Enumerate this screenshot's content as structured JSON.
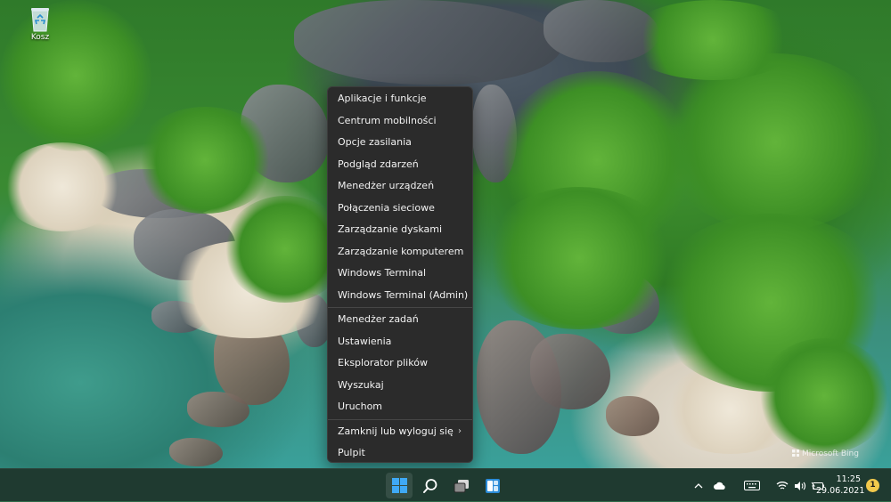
{
  "desktop": {
    "recycle_bin_label": "Kosz"
  },
  "context_menu": {
    "groups": [
      [
        "Aplikacje i funkcje",
        "Centrum mobilności",
        "Opcje zasilania",
        "Podgląd zdarzeń",
        "Menedżer urządzeń",
        "Połączenia sieciowe",
        "Zarządzanie dyskami",
        "Zarządzanie komputerem",
        "Windows Terminal",
        "Windows Terminal (Admin)"
      ],
      [
        "Menedżer zadań",
        "Ustawienia",
        "Eksplorator plików",
        "Wyszukaj",
        "Uruchom"
      ],
      [
        "Zamknij lub wyloguj się",
        "Pulpit"
      ]
    ],
    "submenu_item": "Zamknij lub wyloguj się"
  },
  "watermark": {
    "text": "Microsoft Bing"
  },
  "taskbar": {
    "apps": [
      {
        "name": "start",
        "icon": "windows-logo-icon",
        "active": true
      },
      {
        "name": "search",
        "icon": "search-icon",
        "active": false
      },
      {
        "name": "task-view",
        "icon": "task-view-icon",
        "active": false
      },
      {
        "name": "widgets",
        "icon": "widgets-icon",
        "active": false
      }
    ],
    "tray_icons": [
      "chevron-up-icon",
      "onedrive-cloud-icon",
      "keyboard-icon",
      "wifi-icon",
      "volume-icon",
      "battery-charging-icon"
    ],
    "time": "11:25",
    "date": "29.06.2021",
    "notification_count": "1"
  },
  "colors": {
    "menu_bg": "#2b2b2b",
    "taskbar_bg": "#1f3a30",
    "start_blue": "#3fa9f5",
    "notification": "#f2c94c"
  }
}
